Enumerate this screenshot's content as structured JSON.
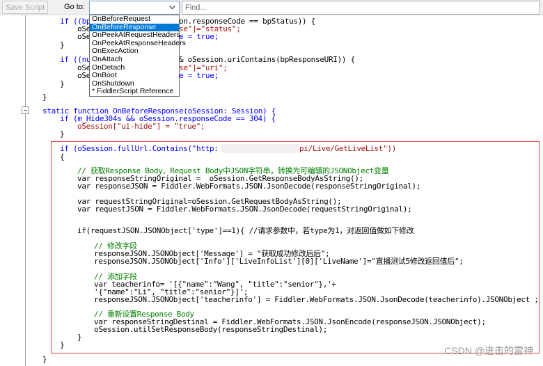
{
  "toolbar": {
    "save_label": "Save Script",
    "goto_label": "Go to:",
    "goto_value": "",
    "find_placeholder": "Find..."
  },
  "dropdown": {
    "items": [
      {
        "label": "OnBeforeRequest",
        "selected": false
      },
      {
        "label": "OnBeforeResponse",
        "selected": true
      },
      {
        "label": "OnPeekAtRequestHeaders",
        "selected": false
      },
      {
        "label": "OnPeekAtResponseHeaders",
        "selected": false
      },
      {
        "label": "OnExecAction",
        "selected": false
      },
      {
        "label": "OnAttach",
        "selected": false
      },
      {
        "label": "OnDetach",
        "selected": false
      },
      {
        "label": "OnBoot",
        "selected": false
      },
      {
        "label": "OnShutdown",
        "selected": false
      },
      {
        "label": "* FiddlerScript Reference",
        "selected": false
      }
    ]
  },
  "code": {
    "l1a": "if ((bp",
    "l1b": "on.responseCode == bpStatus)) {",
    "l2a": "oSe",
    "l2b": "se\"]=\"status\";",
    "l3a": "oSe",
    "l3b": "e = true;",
    "l4": "}",
    "l5a": "if ((nu",
    "l5b": "& oSession.uriContains(bpResponseURI)) {",
    "l6a": "oSe",
    "l6b": "se\"]=\"uri\";",
    "l7a": "oSe",
    "l7b": "e = true;",
    "l8": "}",
    "l9": "}",
    "l10": "static function OnBeforeResponse(oSession: Session) {",
    "l11": "if (m_Hide304s && oSession.responseCode == 304) {",
    "l12": "oSession[\"ui-hide\"] = \"true\";",
    "l13": "}",
    "l14a": "if (oSession.fullUrl.Contains(\"http:",
    "l14b": "pi/Live/GetLiveList\"))",
    "l15": "{",
    "l16": "// 获取Response Body、Request Body中JSON字符串，转换为可编辑的JSONObject变量",
    "l17": "var responseStringOriginal =  oSession.GetResponseBodyAsString();",
    "l18": "var responseJSON = Fiddler.WebFormats.JSON.JsonDecode(responseStringOriginal);",
    "l19": "var requestStringOriginal=oSession.GetRequestBodyAsString();",
    "l20": "var requestJSON = Fiddler.WebFormats.JSON.JsonDecode(requestStringOriginal);",
    "l21": "if(requestJSON.JSONObject['type']==1){ //请求参数中，若type为1，对返回值做如下修改",
    "l22": "// 修改字段",
    "l23": "responseJSON.JSONObject['Message'] = \"获取成功修改后后\";",
    "l24": "responseJSON.JSONObject['Info']['LiveInfoList'][0]['LiveName']=\"直播测试5修改返回值后\";",
    "l25": "// 添加字段",
    "l26": "var teacherinfo= '[{\"name\":\"Wang\", \"title\":\"senior\"},'+",
    "l27": "'{\"name\":\"Li\", \"title\":\"senior\"}]';",
    "l28": "responseJSON.JSONObject['teacherinfo'] = Fiddler.WebFormats.JSON.JsonDecode(teacherinfo).JSONObject ;",
    "l29": "// 重新设置Response Body",
    "l30": "var responseStringDestinal = Fiddler.WebFormats.JSON.JsonEncode(responseJSON.JSONObject);",
    "l31": "oSession.utilSetResponseBody(responseStringDestinal);",
    "l32": "}",
    "l33": "}",
    "l34": "}"
  },
  "watermark": "CSDN @进击的雷神"
}
